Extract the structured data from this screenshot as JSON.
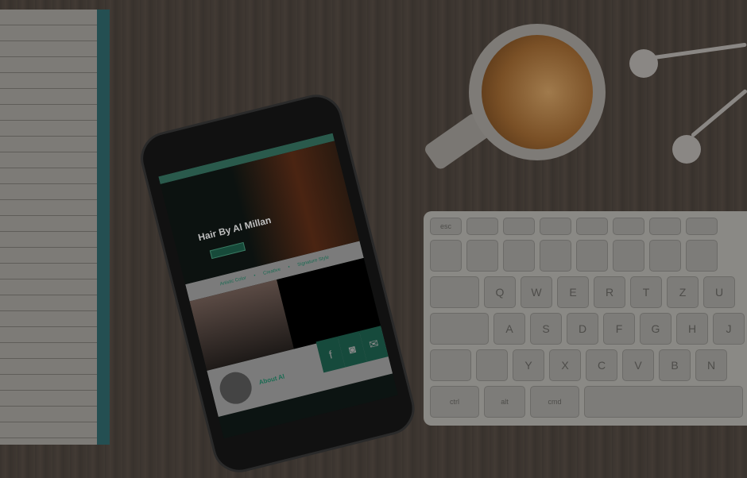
{
  "phone_site": {
    "title": "Hair By Al Millan",
    "tags": [
      "Artistic Color",
      "Creative",
      "Signature Style"
    ],
    "about_heading": "About Al",
    "social_icons": [
      "facebook-icon",
      "instagram-icon",
      "mail-icon"
    ]
  },
  "keyboard": {
    "row1": [
      "esc"
    ],
    "row2": [
      "Q",
      "W",
      "E",
      "R",
      "T",
      "Z",
      "U"
    ],
    "row3": [
      "A",
      "S",
      "D",
      "F",
      "G",
      "H",
      "J"
    ],
    "row4": [
      "Y",
      "X",
      "C",
      "V",
      "B",
      "N"
    ],
    "row5": [
      "ctrl",
      "alt",
      "cmd"
    ]
  }
}
